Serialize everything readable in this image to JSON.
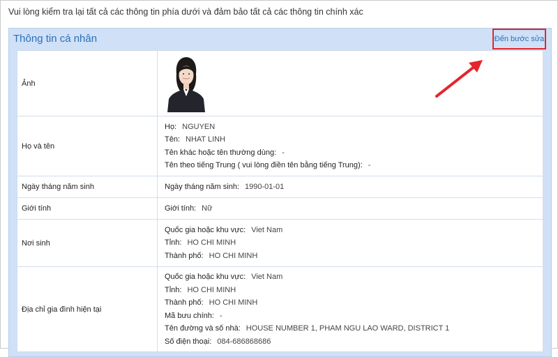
{
  "notice": "Vui lòng kiểm tra lại tất cả các thông tin phía dưới và đảm bảo tất cả các thông tin chính xác",
  "section": {
    "title": "Thông tin cá nhân",
    "edit_link": "Đến bước sửa"
  },
  "rows": {
    "photo": {
      "label": "Ảnh"
    },
    "name": {
      "label": "Họ và tên",
      "fields": [
        {
          "key": "Họ:",
          "value": "NGUYEN"
        },
        {
          "key": "Tên:",
          "value": "NHAT LINH"
        },
        {
          "key": "Tên khác hoặc tên thường dùng:",
          "value": "-"
        },
        {
          "key": "Tên theo tiếng Trung ( vui lòng điền tên bằng tiếng Trung):",
          "value": "-"
        }
      ]
    },
    "dob": {
      "label": "Ngày tháng năm sinh",
      "fields": [
        {
          "key": "Ngày tháng năm sinh:",
          "value": "1990-01-01"
        }
      ]
    },
    "gender": {
      "label": "Giới tính",
      "fields": [
        {
          "key": "Giới tính:",
          "value": "Nữ"
        }
      ]
    },
    "birthplace": {
      "label": "Nơi sinh",
      "fields": [
        {
          "key": "Quốc gia hoặc khu vực:",
          "value": "Viet Nam"
        },
        {
          "key": "Tỉnh:",
          "value": "HO CHI MINH"
        },
        {
          "key": "Thành phố:",
          "value": "HO CHI MINH"
        }
      ]
    },
    "address": {
      "label": "Địa chỉ gia đình hiện tại",
      "fields": [
        {
          "key": "Quốc gia hoặc khu vực:",
          "value": "Viet Nam"
        },
        {
          "key": "Tỉnh:",
          "value": "HO CHI MINH"
        },
        {
          "key": "Thành phố:",
          "value": "HO CHI MINH"
        },
        {
          "key": "Mã bưu chính:",
          "value": "-"
        },
        {
          "key": "Tên đường và số nhà:",
          "value": "HOUSE NUMBER 1, PHAM NGU LAO WARD, DISTRICT 1"
        },
        {
          "key": "Số điện thoại:",
          "value": "084-686868686"
        }
      ]
    }
  },
  "colors": {
    "accent": "#2b6fb8",
    "section_bg": "#cfe0f7",
    "highlight": "#e3262c"
  }
}
